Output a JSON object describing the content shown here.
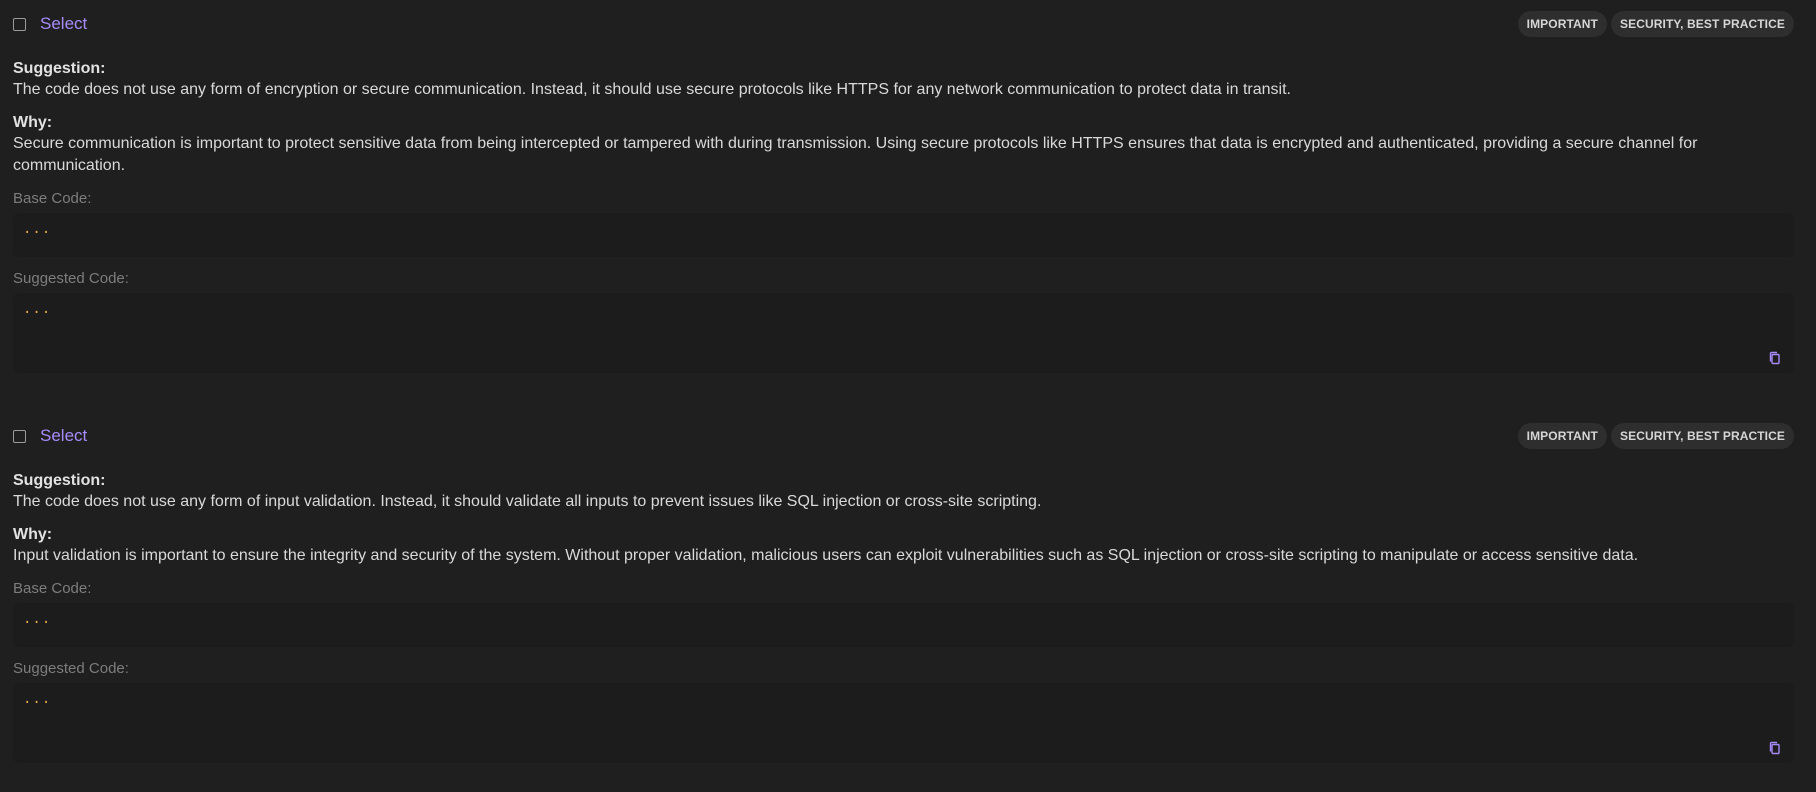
{
  "cards": [
    {
      "select_label": "Select",
      "tags": [
        "IMPORTANT",
        "SECURITY, BEST PRACTICE"
      ],
      "suggestion_label": "Suggestion:",
      "suggestion_text": "The code does not use any form of encryption or secure communication. Instead, it should use secure protocols like HTTPS for any network communication to protect data in transit.",
      "why_label": "Why:",
      "why_text": "Secure communication is important to protect sensitive data from being intercepted or tampered with during transmission. Using secure protocols like HTTPS ensures that data is encrypted and authenticated, providing a secure channel for communication.",
      "base_code_label": "Base Code:",
      "base_code": "...",
      "suggested_code_label": "Suggested Code:",
      "suggested_code": "..."
    },
    {
      "select_label": "Select",
      "tags": [
        "IMPORTANT",
        "SECURITY, BEST PRACTICE"
      ],
      "suggestion_label": "Suggestion:",
      "suggestion_text": "The code does not use any form of input validation. Instead, it should validate all inputs to prevent issues like SQL injection or cross-site scripting.",
      "why_label": "Why:",
      "why_text": "Input validation is important to ensure the integrity and security of the system. Without proper validation, malicious users can exploit vulnerabilities such as SQL injection or cross-site scripting to manipulate or access sensitive data.",
      "base_code_label": "Base Code:",
      "base_code": "...",
      "suggested_code_label": "Suggested Code:",
      "suggested_code": "..."
    }
  ],
  "icons": {
    "copy": "copy-icon"
  },
  "colors": {
    "background": "#1f1f1f",
    "accent": "#a78bfa",
    "code_dots": "#e0a64a",
    "tag_bg": "#2e2e2e"
  }
}
